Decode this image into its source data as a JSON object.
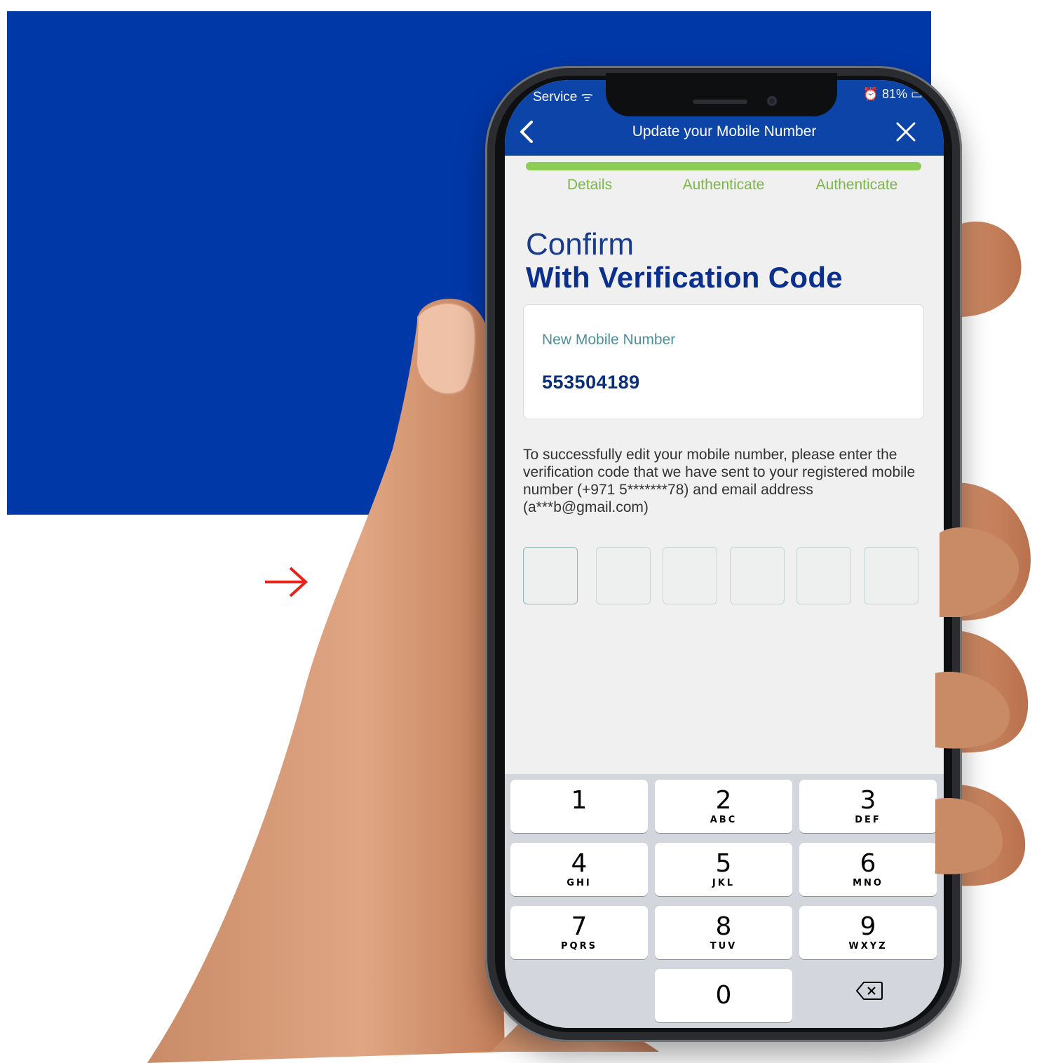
{
  "status_bar": {
    "carrier": "Service",
    "battery": "81%"
  },
  "header": {
    "title": "Update your Mobile Number"
  },
  "steps": [
    "Details",
    "Authenticate",
    "Authenticate"
  ],
  "heading": {
    "line1": "Confirm",
    "line2": "With Verification Code"
  },
  "number_card": {
    "label": "New Mobile Number",
    "value": "553504189"
  },
  "instructions": "To successfully edit your mobile number, please enter the verification code that we have sent to your registered mobile number (+971 5*******78) and email address (a***b@gmail.com)",
  "otp": {
    "length": 6,
    "values": [
      "",
      "",
      "",
      "",
      "",
      ""
    ]
  },
  "keypad": {
    "keys": [
      {
        "digit": "1",
        "letters": ""
      },
      {
        "digit": "2",
        "letters": "ABC"
      },
      {
        "digit": "3",
        "letters": "DEF"
      },
      {
        "digit": "4",
        "letters": "GHI"
      },
      {
        "digit": "5",
        "letters": "JKL"
      },
      {
        "digit": "6",
        "letters": "MNO"
      },
      {
        "digit": "7",
        "letters": "PQRS"
      },
      {
        "digit": "8",
        "letters": "TUV"
      },
      {
        "digit": "9",
        "letters": "WXYZ"
      },
      {
        "digit": "0",
        "letters": ""
      }
    ]
  },
  "colors": {
    "brand_blue": "#0038a8",
    "header_blue": "#0d44a8",
    "progress_green": "#8dcd55",
    "step_green": "#7ab648",
    "arrow_red": "#e8211b"
  }
}
